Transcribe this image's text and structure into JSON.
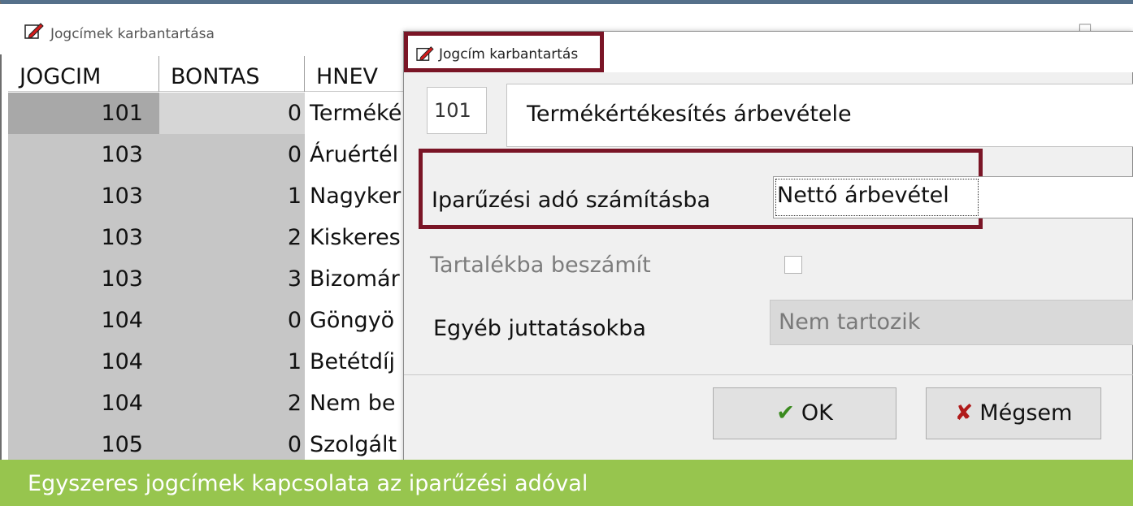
{
  "background_window": {
    "title": "Jogcímek karbantartása",
    "minimize_glyph": "—",
    "maximize_glyph": "☐",
    "grid": {
      "columns": [
        "JOGCIM",
        "BONTAS",
        "HNEV"
      ],
      "rows": [
        {
          "jogcim": "101",
          "bontas": "0",
          "hnev": "Terméké"
        },
        {
          "jogcim": "103",
          "bontas": "0",
          "hnev": "Áruértél"
        },
        {
          "jogcim": "103",
          "bontas": "1",
          "hnev": "Nagyker"
        },
        {
          "jogcim": "103",
          "bontas": "2",
          "hnev": "Kiskeres"
        },
        {
          "jogcim": "103",
          "bontas": "3",
          "hnev": "Bizomár"
        },
        {
          "jogcim": "104",
          "bontas": "0",
          "hnev": "Göngyö"
        },
        {
          "jogcim": "104",
          "bontas": "1",
          "hnev": "Betétdíj"
        },
        {
          "jogcim": "104",
          "bontas": "2",
          "hnev": "Nem be"
        },
        {
          "jogcim": "105",
          "bontas": "0",
          "hnev": "Szolgált"
        }
      ]
    }
  },
  "dialog": {
    "title": "Jogcím karbantartás",
    "jogcim_code": "101",
    "jogcim_name": "Termékértékesítés árbevétele",
    "iparuzesi_label": "Iparűzési adó számításba",
    "iparuzesi_value": "Nettó árbevétel",
    "tartalek_label": "Tartalékba beszámít",
    "tartalek_checked": false,
    "egyeb_label": "Egyéb juttatásokba",
    "egyeb_value": "Nem tartozik",
    "ok_glyph": "✔",
    "ok_label": "OK",
    "cancel_glyph": "✘",
    "cancel_label": "Mégsem"
  },
  "caption": {
    "text": "Egyszeres jogcímek kapcsolata az iparűzési adóval"
  },
  "colors": {
    "highlight": "#7a1526",
    "caption_bg": "#97c54e",
    "ok_check": "#3a8a1e",
    "cancel_x": "#b01a1a"
  },
  "icons": {
    "app_icon": "red-pencil-edit-icon"
  }
}
